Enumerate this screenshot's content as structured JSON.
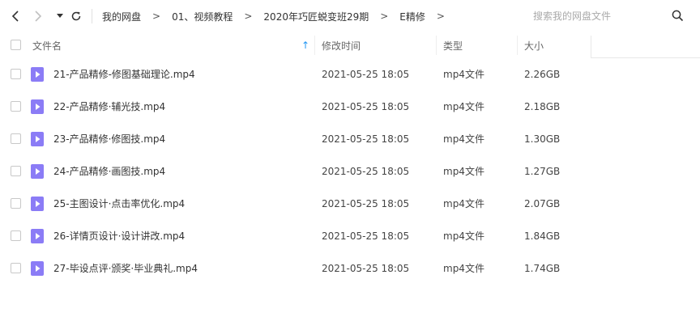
{
  "toolbar": {
    "breadcrumbs": [
      "我的网盘",
      "01、视频教程",
      "2020年巧匠蜕变班29期",
      "E精修"
    ],
    "separator": ">",
    "search_placeholder": "搜索我的网盘文件"
  },
  "columns": {
    "name": "文件名",
    "modified": "修改时间",
    "type": "类型",
    "size": "大小",
    "sort_indicator": "↑"
  },
  "colors": {
    "accent": "#2196f3",
    "file_icon": "#8b7cf6"
  },
  "files": [
    {
      "name": "21-产品精修-修图基础理论.mp4",
      "modified": "2021-05-25 18:05",
      "type": "mp4文件",
      "size": "2.26GB"
    },
    {
      "name": "22-产品精修·辅光技.mp4",
      "modified": "2021-05-25 18:05",
      "type": "mp4文件",
      "size": "2.18GB"
    },
    {
      "name": "23-产品精修·修图技.mp4",
      "modified": "2021-05-25 18:05",
      "type": "mp4文件",
      "size": "1.30GB"
    },
    {
      "name": "24-产品精修·画图技.mp4",
      "modified": "2021-05-25 18:05",
      "type": "mp4文件",
      "size": "1.27GB"
    },
    {
      "name": "25-主图设计·点击率优化.mp4",
      "modified": "2021-05-25 18:05",
      "type": "mp4文件",
      "size": "2.07GB"
    },
    {
      "name": "26-详情页设计·设计讲改.mp4",
      "modified": "2021-05-25 18:05",
      "type": "mp4文件",
      "size": "1.84GB"
    },
    {
      "name": "27-毕设点评·颁奖·毕业典礼.mp4",
      "modified": "2021-05-25 18:05",
      "type": "mp4文件",
      "size": "1.74GB"
    }
  ]
}
